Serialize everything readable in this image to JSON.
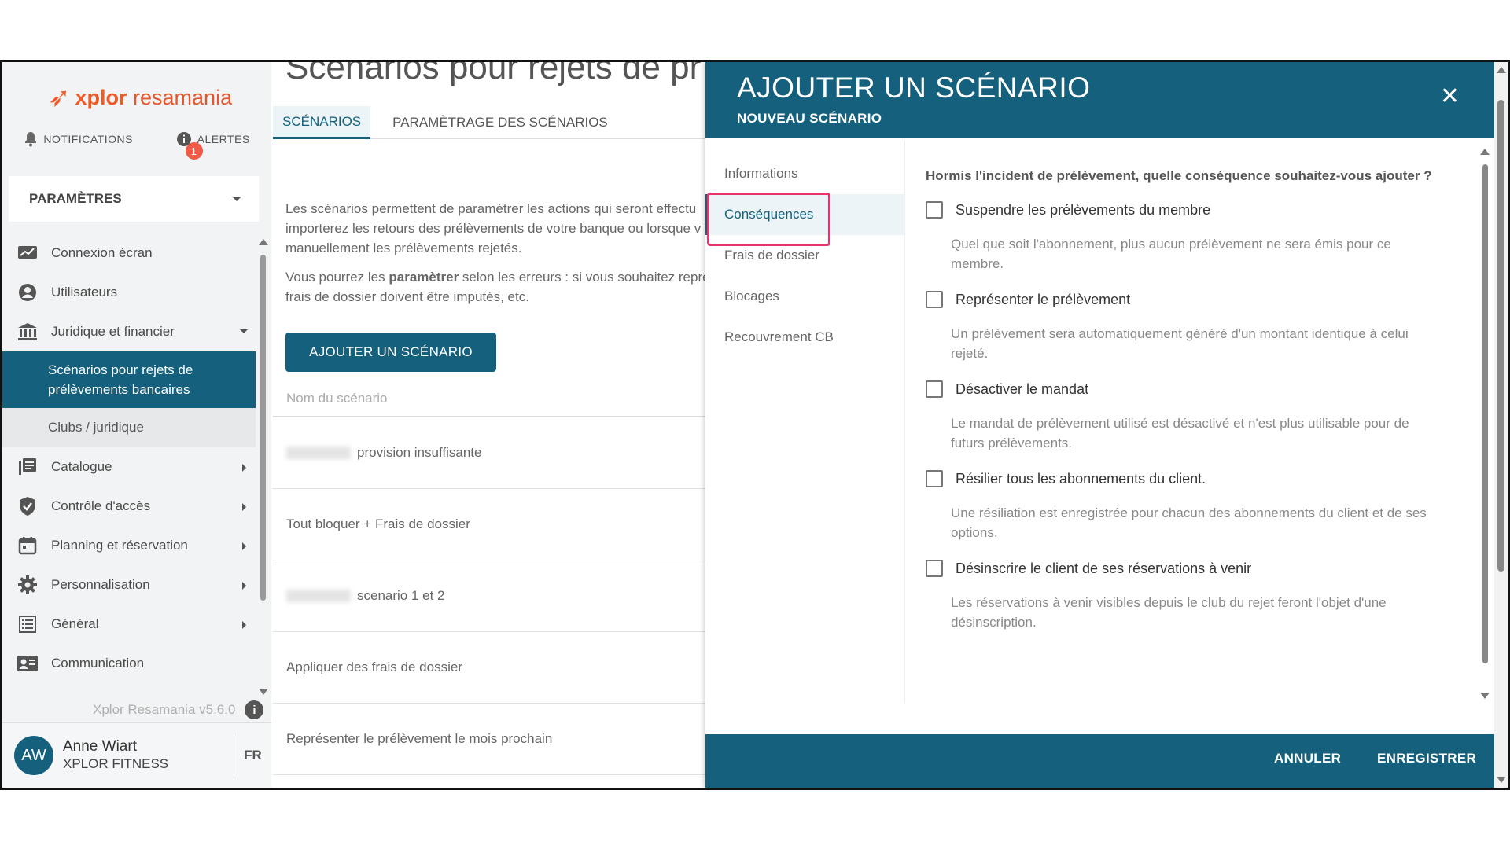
{
  "brand": {
    "logo_x": "xplor",
    "logo_r": "resamania"
  },
  "topnav": {
    "notifications": "NOTIFICATIONS",
    "alerts": "ALERTES",
    "alerts_count": "1"
  },
  "sidebar": {
    "section": "PARAMÈTRES",
    "items": [
      {
        "label": "Connexion écran"
      },
      {
        "label": "Utilisateurs"
      },
      {
        "label": "Juridique et financier"
      },
      {
        "label": "Catalogue"
      },
      {
        "label": "Contrôle d'accès"
      },
      {
        "label": "Planning et réservation"
      },
      {
        "label": "Personnalisation"
      },
      {
        "label": "Général"
      },
      {
        "label": "Communication"
      }
    ],
    "sub_active": "Scénarios pour rejets de prélèvements bancaires",
    "sub_other": "Clubs / juridique",
    "version": "Xplor Resamania v5.6.0"
  },
  "user": {
    "initials": "AW",
    "name": "Anne Wiart",
    "company": "XPLOR FITNESS",
    "lang": "FR"
  },
  "main": {
    "title": "Scénarios pour rejets de pr",
    "tabs": [
      "SCÉNARIOS",
      "PARAMÈTRAGE DES SCÉNARIOS"
    ],
    "intro1_l1": "Les scénarios permettent de paramétrer les actions qui seront effectu",
    "intro1_l2": "importerez les retours des prélèvements de votre banque ou lorsque v",
    "intro1_l3": "manuellement les prélèvements rejetés.",
    "intro2_pre": "Vous pourrez les ",
    "intro2_bold": "paramètrer",
    "intro2_post": " selon les erreurs : si vous souhaitez représ",
    "intro2_l2": "frais de dossier doivent être imputés, etc.",
    "add_button": "AJOUTER UN SCÉNARIO",
    "column": "Nom du scénario",
    "rows": [
      "provision insuffisante",
      "Tout bloquer + Frais de dossier",
      "scenario 1 et 2",
      "Appliquer des frais de dossier",
      "Représenter le prélèvement le mois prochain"
    ]
  },
  "modal": {
    "title": "AJOUTER UN SCÉNARIO",
    "subtitle": "NOUVEAU SCÉNARIO",
    "nav": [
      "Informations",
      "Conséquences",
      "Frais de dossier",
      "Blocages",
      "Recouvrement CB"
    ],
    "question": "Hormis l'incident de prélèvement, quelle conséquence souhaitez-vous ajouter ?",
    "options": [
      {
        "label": "Suspendre les prélèvements du membre",
        "desc": "Quel que soit l'abonnement, plus aucun prélèvement ne sera émis pour ce membre."
      },
      {
        "label": "Représenter le prélèvement",
        "desc": "Un prélèvement sera automatiquement généré d'un montant identique à celui rejeté."
      },
      {
        "label": "Désactiver le mandat",
        "desc": "Le mandat de prélèvement utilisé est désactivé et n'est plus utilisable pour de futurs prélèvements."
      },
      {
        "label": "Résilier tous les abonnements du client.",
        "desc": "Une résiliation est enregistrée pour chacun des abonnements du client et de ses options."
      },
      {
        "label": "Désinscrire le client de ses réservations à venir",
        "desc": "Les réservations à venir visibles depuis le club du rejet feront l'objet d'une désinscription."
      }
    ],
    "cancel": "ANNULER",
    "save": "ENREGISTRER"
  },
  "colors": {
    "primary": "#14607d",
    "accent": "#f05a28",
    "highlight": "#e8336d",
    "badge": "#f15a47"
  }
}
